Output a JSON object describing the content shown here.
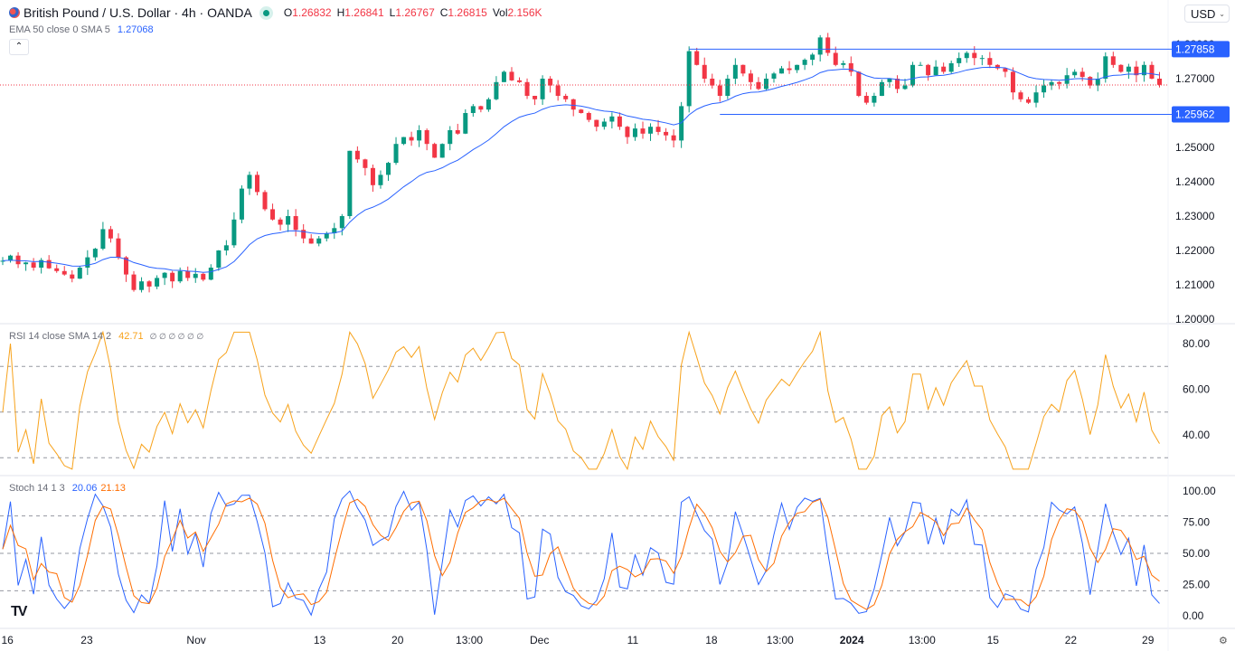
{
  "header": {
    "symbol_title": "British Pound / U.S. Dollar · 4h · OANDA",
    "ohlc": [
      {
        "label": "O",
        "value": "1.26832"
      },
      {
        "label": "H",
        "value": "1.26841"
      },
      {
        "label": "L",
        "value": "1.26767"
      },
      {
        "label": "C",
        "value": "1.26815"
      },
      {
        "label": "Vol",
        "value": "2.156K"
      }
    ],
    "ema_label": "EMA 50 close 0 SMA 5",
    "ema_value": "1.27068",
    "collapse_icon": "chevron-up-icon",
    "currency": "USD"
  },
  "rsi_legend": {
    "label": "RSI 14 close SMA 14 2",
    "value": "42.71",
    "hidden_values": "∅ ∅ ∅ ∅ ∅ ∅"
  },
  "stoch_legend": {
    "label": "Stoch 14 1 3",
    "k_value": "20.06",
    "d_value": "21.13"
  },
  "colors": {
    "up": "#089981",
    "down": "#f23645",
    "ema": "#2962ff",
    "rsi": "#f7a21b",
    "stoch_k": "#2962ff",
    "stoch_d": "#ff6d00",
    "level_line": "#2962ff"
  },
  "chart_data": {
    "type": "candlestick",
    "price_axis": {
      "ticks": [
        "1.20000",
        "1.21000",
        "1.22000",
        "1.23000",
        "1.24000",
        "1.25000",
        "1.26000",
        "1.27000",
        "1.28000"
      ],
      "ylim": [
        1.1995,
        1.2865
      ]
    },
    "level_lines": [
      {
        "value": "1.27858",
        "from_index": 89
      },
      {
        "value": "1.25962",
        "from_index": 93
      }
    ],
    "last_price": 1.26815,
    "time_axis": [
      {
        "label": "16",
        "at": 0.6
      },
      {
        "label": "23",
        "at": 10.9
      },
      {
        "label": "Nov",
        "at": 25.1
      },
      {
        "label": "13",
        "at": 41.1
      },
      {
        "label": "20",
        "at": 51.2
      },
      {
        "label": "13:00",
        "at": 60.5
      },
      {
        "label": "Dec",
        "at": 69.6
      },
      {
        "label": "11",
        "at": 81.7
      },
      {
        "label": "18",
        "at": 91.9
      },
      {
        "label": "13:00",
        "at": 100.8
      },
      {
        "label": "2024",
        "at": 110.1,
        "bold": true
      },
      {
        "label": "13:00",
        "at": 119.2
      },
      {
        "label": "15",
        "at": 128.4
      },
      {
        "label": "22",
        "at": 138.5
      },
      {
        "label": "29",
        "at": 148.5
      }
    ],
    "closes": [
      1.217,
      1.2185,
      1.216,
      1.2165,
      1.215,
      1.2172,
      1.2148,
      1.214,
      1.213,
      1.2118,
      1.215,
      1.218,
      1.2205,
      1.2262,
      1.2235,
      1.218,
      1.213,
      1.2085,
      1.211,
      1.2095,
      1.212,
      1.2135,
      1.211,
      1.214,
      1.212,
      1.2132,
      1.2115,
      1.215,
      1.22,
      1.2215,
      1.229,
      1.238,
      1.242,
      1.237,
      1.232,
      1.229,
      1.2275,
      1.23,
      1.226,
      1.2235,
      1.222,
      1.2235,
      1.225,
      1.2265,
      1.23,
      1.249,
      1.2465,
      1.244,
      1.239,
      1.242,
      1.2455,
      1.251,
      1.253,
      1.252,
      1.255,
      1.251,
      1.247,
      1.251,
      1.255,
      1.254,
      1.26,
      1.262,
      1.261,
      1.264,
      1.269,
      1.272,
      1.2695,
      1.269,
      1.265,
      1.264,
      1.27,
      1.268,
      1.265,
      1.264,
      1.261,
      1.26,
      1.258,
      1.256,
      1.2575,
      1.259,
      1.256,
      1.253,
      1.2555,
      1.254,
      1.256,
      1.2545,
      1.2535,
      1.252,
      1.262,
      1.278,
      1.274,
      1.27,
      1.268,
      1.265,
      1.27,
      1.274,
      1.2715,
      1.269,
      1.267,
      1.27,
      1.2715,
      1.273,
      1.2725,
      1.274,
      1.2755,
      1.277,
      1.282,
      1.2775,
      1.274,
      1.2745,
      1.272,
      1.265,
      1.263,
      1.265,
      1.269,
      1.27,
      1.267,
      1.268,
      1.274,
      1.274,
      1.271,
      1.2735,
      1.272,
      1.2745,
      1.276,
      1.2775,
      1.276,
      1.276,
      1.274,
      1.273,
      1.272,
      1.266,
      1.264,
      1.263,
      1.266,
      1.268,
      1.269,
      1.2685,
      1.271,
      1.272,
      1.2705,
      1.268,
      1.27,
      1.2765,
      1.274,
      1.272,
      1.2735,
      1.271,
      1.274,
      1.27,
      1.2682
    ],
    "ema_period": 50,
    "rsi": {
      "axis_ticks": [
        "40.00",
        "60.00",
        "80.00"
      ],
      "ylim": [
        28,
        86
      ],
      "bands": [
        70,
        50,
        30
      ]
    },
    "stoch": {
      "axis_ticks": [
        "0.00",
        "25.00",
        "50.00",
        "75.00",
        "100.00"
      ],
      "ylim": [
        -3,
        105
      ],
      "bands": [
        80,
        50,
        20
      ]
    }
  }
}
